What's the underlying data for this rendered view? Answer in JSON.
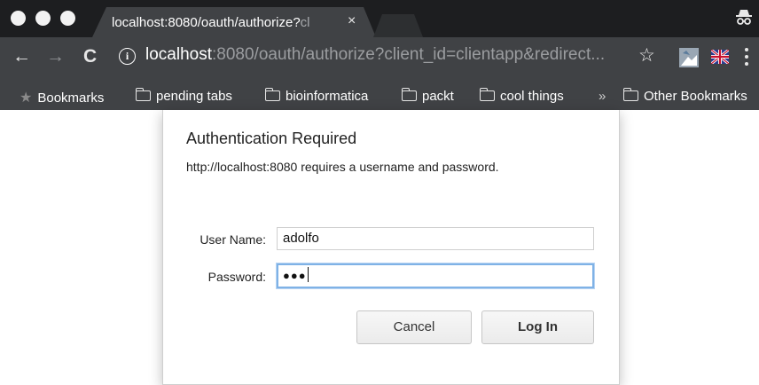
{
  "tab": {
    "title_main": "localhost:8080/oauth/authorize?",
    "title_fade": "cl",
    "close_glyph": "×"
  },
  "toolbar": {
    "back_glyph": "←",
    "forward_glyph": "→",
    "reload_glyph": "C",
    "info_glyph": "i",
    "url_host": "localhost",
    "url_rest": ":8080/oauth/authorize?client_id=clientapp&redirect...",
    "star_glyph": "☆"
  },
  "bookmarks": {
    "bar_label": "Bookmarks",
    "items": [
      "pending tabs",
      "bioinformatica",
      "packt",
      "cool things"
    ],
    "overflow_glyph": "»",
    "other_label": "Other Bookmarks"
  },
  "dialog": {
    "title": "Authentication Required",
    "message": "http://localhost:8080 requires a username and password.",
    "username_label": "User Name:",
    "username_value": "adolfo",
    "password_label": "Password:",
    "password_value": "●●●",
    "cancel_label": "Cancel",
    "login_label": "Log In"
  },
  "icons": {
    "incognito": "incognito-icon",
    "info": "info-icon",
    "star": "star-icon",
    "folder": "folder-icon"
  }
}
